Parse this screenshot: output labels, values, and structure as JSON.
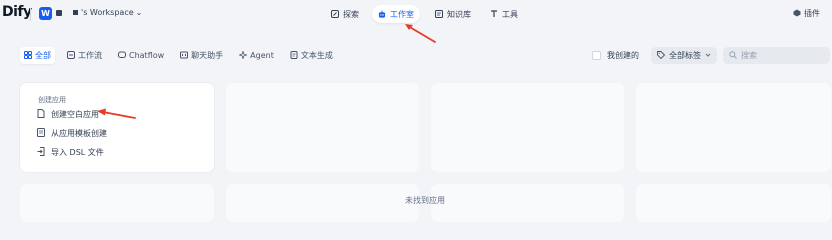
{
  "header": {
    "logo": "Dify",
    "workspace_initial": "W",
    "workspace_name": "'s Workspace",
    "workspace_caret": "⌄",
    "nav": [
      {
        "label": "探索",
        "icon": "explore-icon"
      },
      {
        "label": "工作室",
        "icon": "studio-icon"
      },
      {
        "label": "知识库",
        "icon": "knowledge-icon"
      },
      {
        "label": "工具",
        "icon": "tools-icon"
      }
    ],
    "plugins_label": "插件"
  },
  "filters": {
    "tabs": [
      {
        "label": "全部",
        "icon": "grid-icon"
      },
      {
        "label": "工作流",
        "icon": "workflow-icon"
      },
      {
        "label": "Chatflow",
        "icon": "chatflow-icon"
      },
      {
        "label": "聊天助手",
        "icon": "chat-icon"
      },
      {
        "label": "Agent",
        "icon": "agent-icon"
      },
      {
        "label": "文本生成",
        "icon": "text-icon"
      }
    ],
    "mine_label": "我创建的",
    "tags_label": "全部标签",
    "search_placeholder": "搜索"
  },
  "create_card": {
    "title": "创建应用",
    "items": [
      {
        "label": "创建空白应用",
        "icon": "blank-file-icon"
      },
      {
        "label": "从应用模板创建",
        "icon": "template-icon"
      },
      {
        "label": "导入 DSL 文件",
        "icon": "import-icon"
      }
    ]
  },
  "empty_state": "未找到应用",
  "colors": {
    "accent": "#155eef",
    "annotation_arrow": "#e8392a",
    "background": "#f2f4f7"
  }
}
